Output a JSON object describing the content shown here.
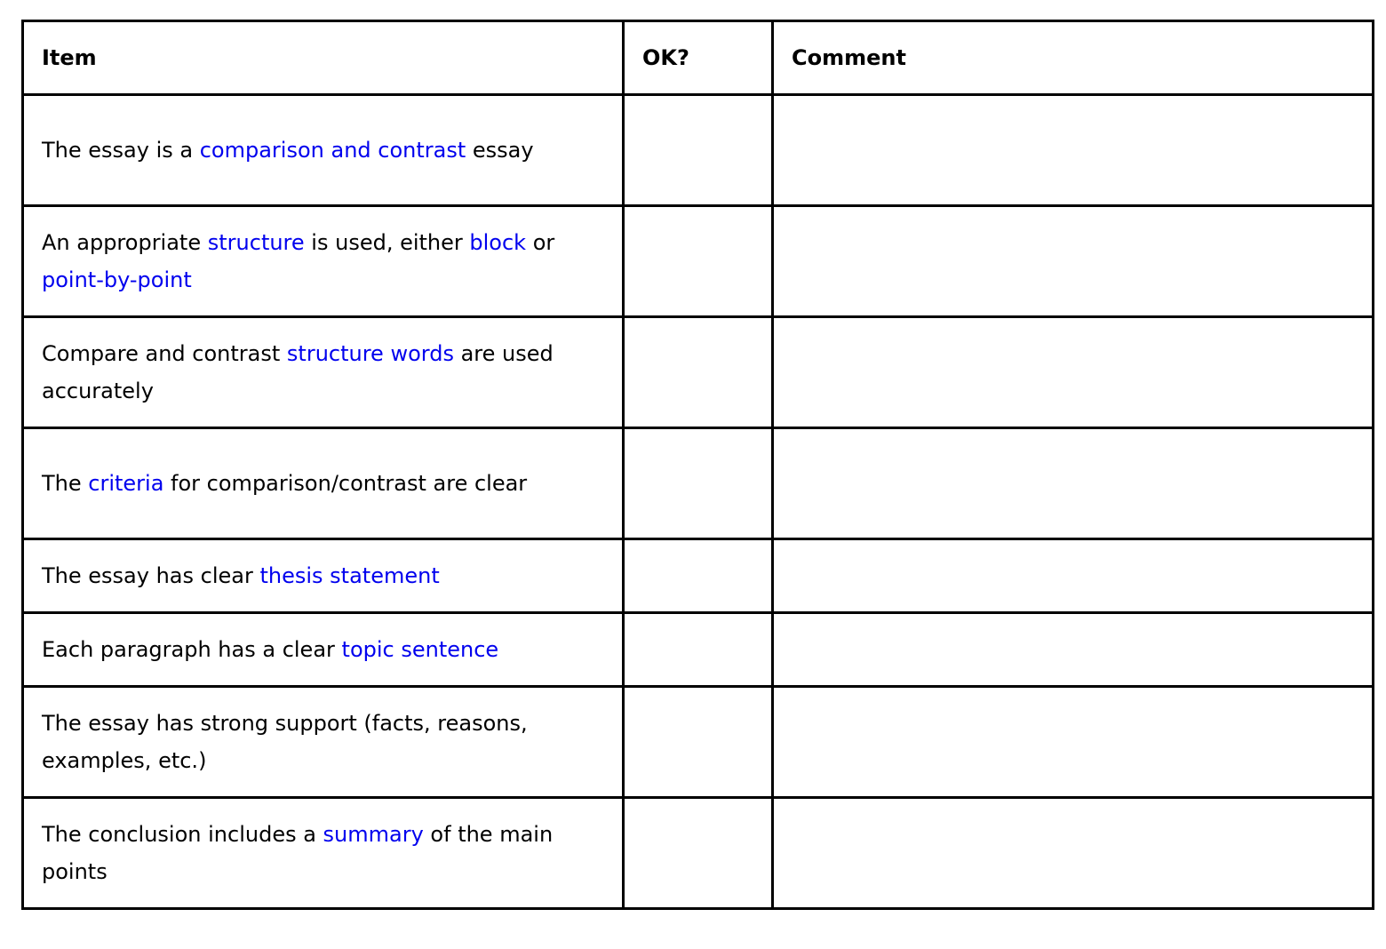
{
  "header": {
    "item": "Item",
    "ok": "OK?",
    "comment": "Comment"
  },
  "link_color": "#0000ee",
  "rows": [
    {
      "segments": [
        {
          "text": "The essay is a ",
          "link": false
        },
        {
          "text": "comparison and contrast",
          "link": true
        },
        {
          "text": " essay",
          "link": false
        }
      ],
      "ok": "",
      "comment": ""
    },
    {
      "segments": [
        {
          "text": "An appropriate ",
          "link": false
        },
        {
          "text": "structure",
          "link": true
        },
        {
          "text": " is used, either ",
          "link": false
        },
        {
          "text": "block",
          "link": true
        },
        {
          "text": " or ",
          "link": false
        },
        {
          "text": "point-by-point",
          "link": true
        }
      ],
      "ok": "",
      "comment": ""
    },
    {
      "segments": [
        {
          "text": "Compare and contrast ",
          "link": false
        },
        {
          "text": "structure words",
          "link": true
        },
        {
          "text": " are used accurately",
          "link": false
        }
      ],
      "ok": "",
      "comment": ""
    },
    {
      "segments": [
        {
          "text": "The ",
          "link": false
        },
        {
          "text": "criteria",
          "link": true
        },
        {
          "text": " for comparison/contrast are clear",
          "link": false
        }
      ],
      "ok": "",
      "comment": ""
    },
    {
      "segments": [
        {
          "text": "The essay has clear ",
          "link": false
        },
        {
          "text": "thesis statement",
          "link": true
        }
      ],
      "ok": "",
      "comment": ""
    },
    {
      "segments": [
        {
          "text": "Each paragraph has a clear ",
          "link": false
        },
        {
          "text": "topic sentence",
          "link": true
        }
      ],
      "ok": "",
      "comment": ""
    },
    {
      "segments": [
        {
          "text": "The essay has strong support (facts, reasons, examples, etc.)",
          "link": false
        }
      ],
      "ok": "",
      "comment": ""
    },
    {
      "segments": [
        {
          "text": "The conclusion includes a ",
          "link": false
        },
        {
          "text": "summary",
          "link": true
        },
        {
          "text": " of the main points",
          "link": false
        }
      ],
      "ok": "",
      "comment": ""
    }
  ]
}
